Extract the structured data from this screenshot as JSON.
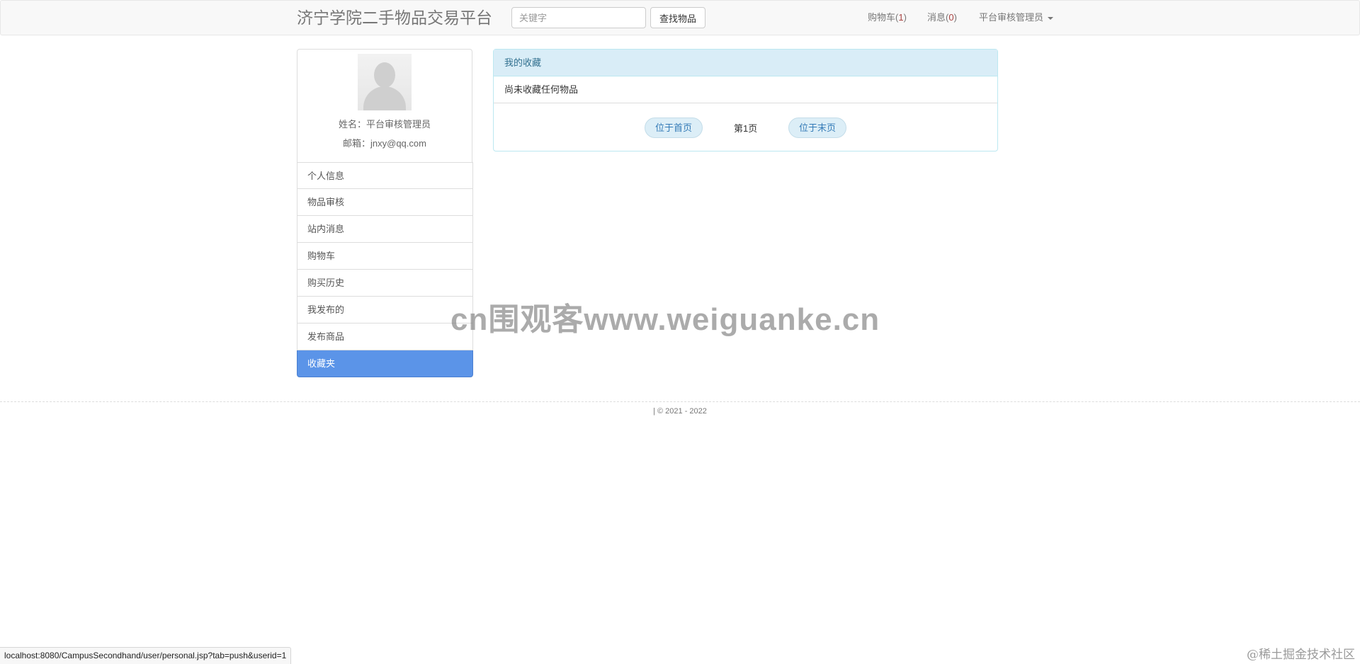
{
  "navbar": {
    "brand": "济宁学院二手物品交易平台",
    "search_placeholder": "关键字",
    "search_button": "查找物品",
    "cart_label": "购物车(",
    "cart_count": "1",
    "cart_close": ")",
    "messages_label": "消息(",
    "messages_count": "0",
    "messages_close": ")",
    "user_menu": "平台审核管理员"
  },
  "profile": {
    "name": "姓名：平台审核管理员",
    "email": "邮箱：jnxy@qq.com"
  },
  "sidebar": {
    "items": [
      {
        "label": "个人信息"
      },
      {
        "label": "物品审核"
      },
      {
        "label": "站内消息"
      },
      {
        "label": "购物车"
      },
      {
        "label": "购买历史"
      },
      {
        "label": "我发布的"
      },
      {
        "label": "发布商品"
      },
      {
        "label": "收藏夹"
      }
    ],
    "active": "收藏夹"
  },
  "favorites": {
    "heading": "我的收藏",
    "empty_text": "尚未收藏任何物品",
    "first_page": "位于首页",
    "current_page": "第1页",
    "last_page": "位于末页"
  },
  "footer": {
    "text": "| © 2021 - 2022"
  },
  "watermark": "cn围观客www.weiguanke.cn",
  "status_bar": "localhost:8080/CampusSecondhand/user/personal.jsp?tab=push&userid=1",
  "corner_credit": "@稀土掘金技术社区",
  "colors": {
    "active_item": "#5b94e8",
    "panel_heading": "#d9edf7",
    "count": "#a94442"
  }
}
